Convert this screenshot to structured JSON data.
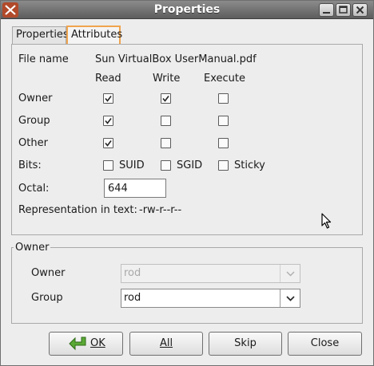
{
  "window": {
    "title": "Properties"
  },
  "tabs": [
    {
      "label": "Properties"
    },
    {
      "label": "Attributes",
      "active": true
    }
  ],
  "attributes": {
    "file_name_label": "File name",
    "file_name_value": "Sun VirtualBox UserManual.pdf",
    "col_read": "Read",
    "col_write": "Write",
    "col_execute": "Execute",
    "rows": [
      {
        "label": "Owner",
        "read": true,
        "write": true,
        "execute": false
      },
      {
        "label": "Group",
        "read": true,
        "write": false,
        "execute": false
      },
      {
        "label": "Other",
        "read": true,
        "write": false,
        "execute": false
      }
    ],
    "bits_label": "Bits:",
    "bits": [
      {
        "label": "SUID",
        "checked": false
      },
      {
        "label": "SGID",
        "checked": false
      },
      {
        "label": "Sticky",
        "checked": false
      }
    ],
    "octal_label": "Octal:",
    "octal_value": "644",
    "repr_label": "Representation in text:",
    "repr_value": "-rw-r--r--"
  },
  "owner_group": {
    "title": "Owner",
    "owner_label": "Owner",
    "owner_value": "rod",
    "group_label": "Group",
    "group_value": "rod"
  },
  "buttons": {
    "ok_label": "OK",
    "all_label": "All",
    "skip_label": "Skip",
    "close_label": "Close"
  },
  "colors": {
    "titlebar": "#5d5d5d",
    "active_tab_border": "#f0a44d",
    "ok_icon": "#4a9d2b"
  }
}
